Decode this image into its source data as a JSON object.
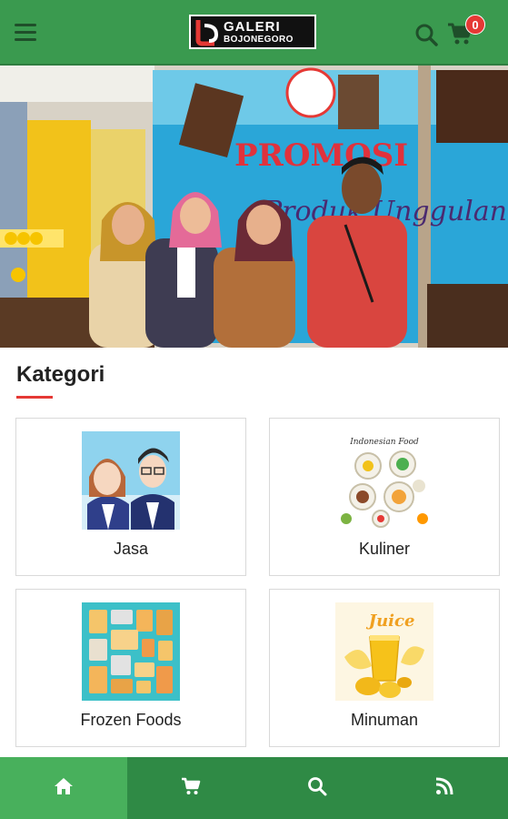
{
  "app": {
    "logo_line1": "GALERI",
    "logo_line2": "BOJONEGORO",
    "cart_count": "0",
    "accent_green": "#3a9a4f",
    "accent_red": "#e53935"
  },
  "header": {
    "menu_icon": "hamburger-menu-icon",
    "search_icon": "search-icon",
    "cart_icon": "cart-icon"
  },
  "banner": {
    "slide_count": 4,
    "active_slide": 2,
    "sign_text_1": "PROMOSI",
    "sign_text_2": "Produk Unggulan"
  },
  "categories": {
    "title": "Kategori",
    "items": [
      {
        "label": "Jasa",
        "icon": "people-icon"
      },
      {
        "label": "Kuliner",
        "icon": "food-icon"
      },
      {
        "label": "Frozen Foods",
        "icon": "frozen-food-icon"
      },
      {
        "label": "Minuman",
        "icon": "juice-icon"
      }
    ]
  },
  "bottom_nav": {
    "items": [
      {
        "icon": "home-icon",
        "active": true
      },
      {
        "icon": "cart-icon",
        "active": false
      },
      {
        "icon": "search-icon",
        "active": false
      },
      {
        "icon": "rss-icon",
        "active": false
      }
    ]
  }
}
